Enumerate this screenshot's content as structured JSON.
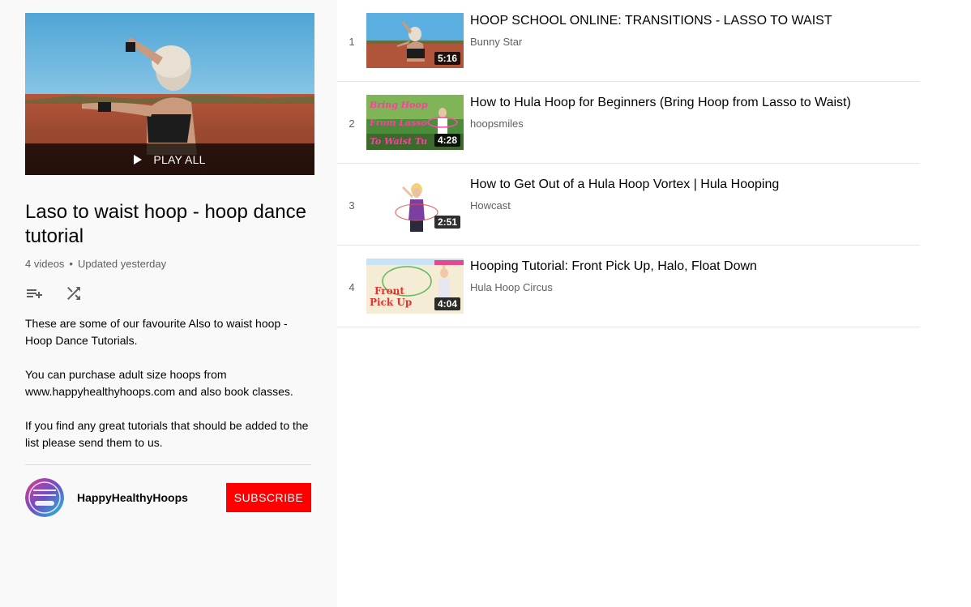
{
  "playlist": {
    "play_all_label": "PLAY ALL",
    "title": "Laso to waist hoop - hoop dance tutorial",
    "video_count": "4 videos",
    "separator": "•",
    "updated": "Updated yesterday",
    "description": [
      "These are some of our favourite Also to waist hoop - Hoop Dance Tutorials.",
      "You can purchase adult size hoops from www.happyhealthyhoops.com and also book classes.",
      "If you find any great tutorials that should be added to the list please send them to us."
    ],
    "owner": {
      "name": "HappyHealthyHoops",
      "avatar_text": "HAPPY HEALTHY hoops"
    },
    "subscribe_label": "SUBSCRIBE",
    "icons": {
      "save": "playlist-add-icon",
      "shuffle": "shuffle-icon",
      "play": "play-icon"
    }
  },
  "videos": [
    {
      "index": "1",
      "title": "HOOP SCHOOL ONLINE: TRANSITIONS - LASSO TO WAIST",
      "channel": "Bunny Star",
      "duration": "5:16"
    },
    {
      "index": "2",
      "title": "How to Hula Hoop for Beginners (Bring Hoop from Lasso to Waist)",
      "channel": "hoopsmiles",
      "duration": "4:28",
      "thumb_text": [
        "Bring Hoop",
        "From Lasso",
        "To Waist Tu"
      ]
    },
    {
      "index": "3",
      "title": "How to Get Out of a Hula Hoop Vortex | Hula Hooping",
      "channel": "Howcast",
      "duration": "2:51"
    },
    {
      "index": "4",
      "title": "Hooping Tutorial: Front Pick Up, Halo, Float Down",
      "channel": "Hula Hoop Circus",
      "duration": "4:04",
      "thumb_text": [
        "Front",
        "Pick Up"
      ]
    }
  ],
  "colors": {
    "subscribe": "#ff0000",
    "sidebar_bg": "#f9f9f9",
    "secondary_text": "#606060"
  }
}
